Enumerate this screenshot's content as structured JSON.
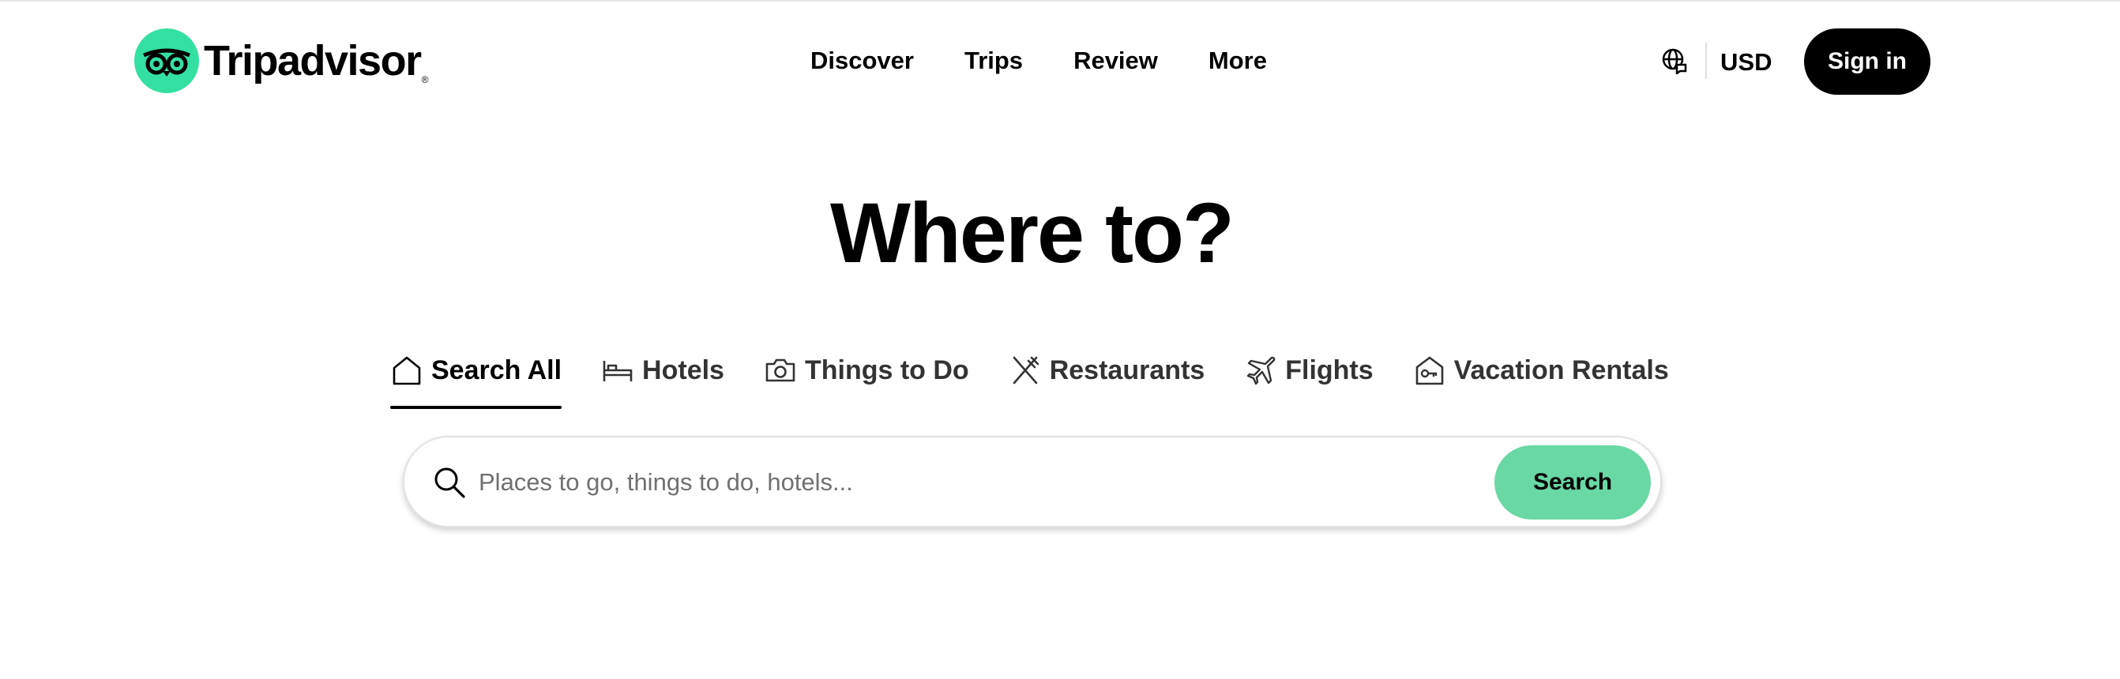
{
  "header": {
    "brand": "Tripadvisor",
    "trademark": "®",
    "nav": [
      {
        "label": "Discover"
      },
      {
        "label": "Trips"
      },
      {
        "label": "Review"
      },
      {
        "label": "More"
      }
    ],
    "language_icon": "globe-icon",
    "currency": "USD",
    "sign_in": "Sign in"
  },
  "hero": {
    "title": "Where to?"
  },
  "tabs": [
    {
      "label": "Search All",
      "icon": "house-icon",
      "active": true
    },
    {
      "label": "Hotels",
      "icon": "bed-icon",
      "active": false
    },
    {
      "label": "Things to Do",
      "icon": "camera-icon",
      "active": false
    },
    {
      "label": "Restaurants",
      "icon": "utensils-icon",
      "active": false
    },
    {
      "label": "Flights",
      "icon": "airplane-icon",
      "active": false
    },
    {
      "label": "Vacation Rentals",
      "icon": "rental-house-key-icon",
      "active": false
    }
  ],
  "search": {
    "placeholder": "Places to go, things to do, hotels...",
    "value": "",
    "button_label": "Search"
  },
  "colors": {
    "brand_green": "#34e0a1",
    "search_button": "#6ad8a4",
    "signin_bg": "#000000"
  }
}
